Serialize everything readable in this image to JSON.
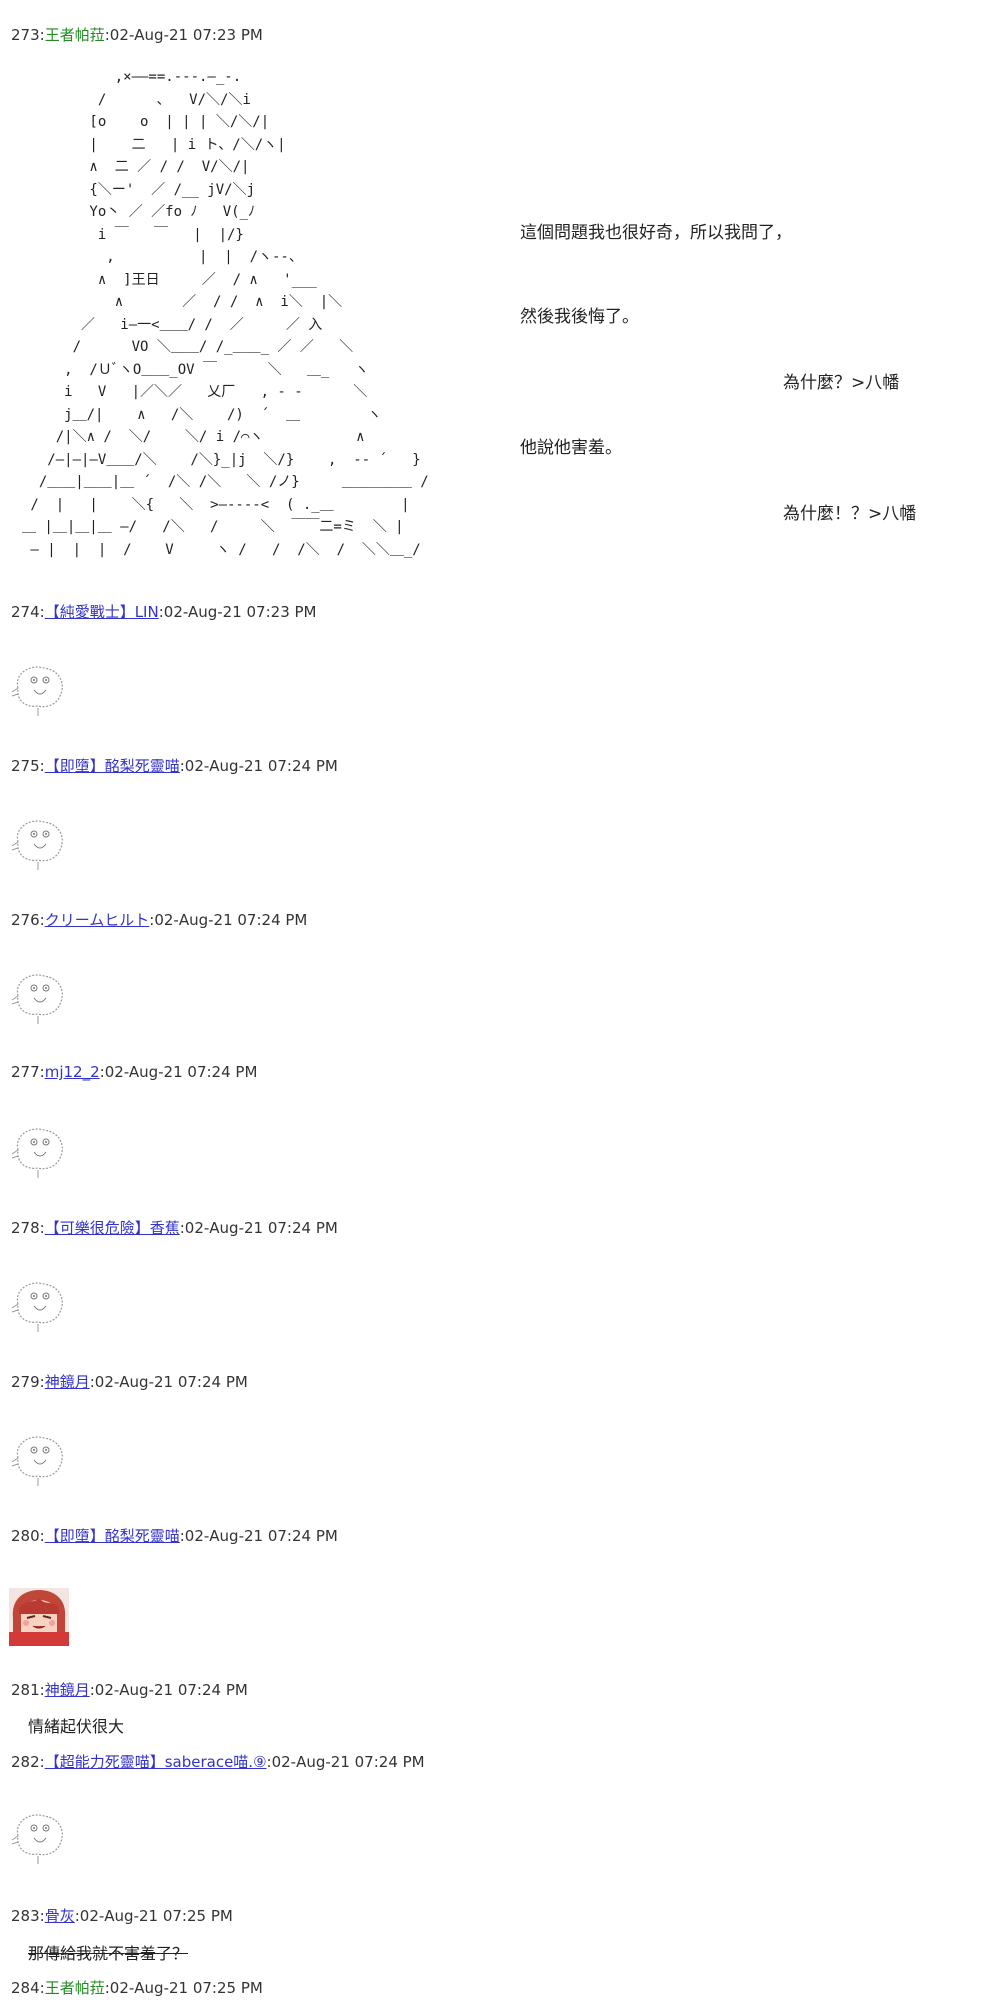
{
  "posts": [
    {
      "num": "273",
      "name": "王者帕菈",
      "date": "02-Aug-21 07:23 PM"
    },
    {
      "num": "274",
      "name": "【純愛戰士】LIN",
      "date": "02-Aug-21 07:23 PM"
    },
    {
      "num": "275",
      "name": "【即墮】酩梨死靈喵",
      "date": "02-Aug-21 07:24 PM"
    },
    {
      "num": "276",
      "name": "クリームヒルト",
      "date": "02-Aug-21 07:24 PM"
    },
    {
      "num": "277",
      "name": "mj12_2",
      "date": "02-Aug-21 07:24 PM"
    },
    {
      "num": "278",
      "name": "【可樂很危險】香蕉",
      "date": "02-Aug-21 07:24 PM"
    },
    {
      "num": "279",
      "name": "神鏡月",
      "date": "02-Aug-21 07:24 PM"
    },
    {
      "num": "280",
      "name": "【即墮】酩梨死靈喵",
      "date": "02-Aug-21 07:24 PM"
    },
    {
      "num": "281",
      "name": "神鏡月",
      "date": "02-Aug-21 07:24 PM",
      "body": "情緒起伏很大"
    },
    {
      "num": "282",
      "name": "【超能力死靈喵】saberace喵.⑨",
      "date": "02-Aug-21 07:24 PM"
    },
    {
      "num": "283",
      "name": "骨灰",
      "date": "02-Aug-21 07:25 PM",
      "body": "那傳給我就不害羞了？"
    },
    {
      "num": "284",
      "name": "王者帕菈",
      "date": "02-Aug-21 07:25 PM"
    }
  ],
  "story": {
    "line1": "這個問題我也很好奇，所以我問了，",
    "line2": "然後我後悔了。",
    "line3": "為什麼？>八幡",
    "line4": "他說他害羞。",
    "line5": "為什麼！？>八幡"
  },
  "colors": {
    "name_green": "#228b22",
    "name_link": "#3333cc"
  }
}
